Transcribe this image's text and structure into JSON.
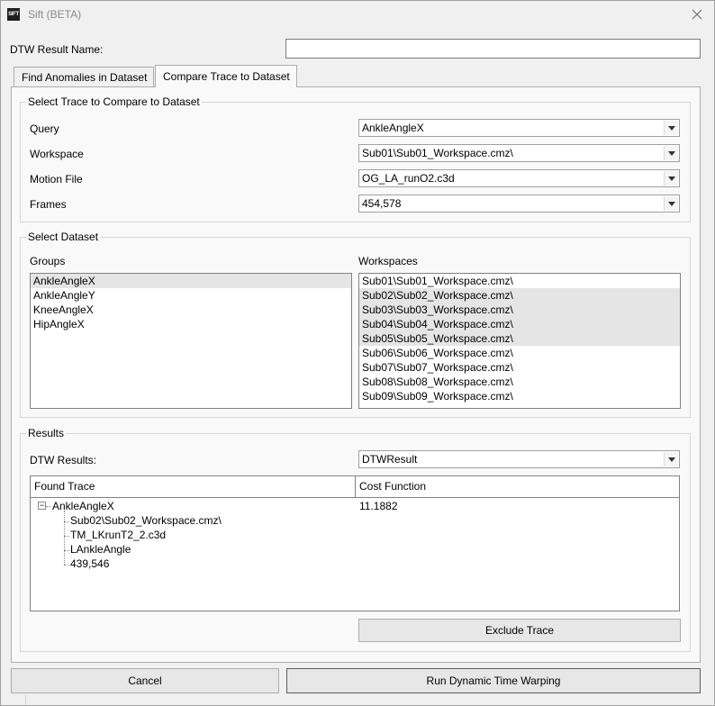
{
  "window": {
    "title": "Sift (BETA)",
    "icon_text": "SIFT"
  },
  "result_name": {
    "label": "DTW Result Name:",
    "value": ""
  },
  "tabs": [
    {
      "label": "Find Anomalies in Dataset"
    },
    {
      "label": "Compare Trace to Dataset"
    }
  ],
  "select_trace": {
    "title": "Select Trace to Compare to Dataset",
    "fields": [
      {
        "label": "Query",
        "value": "AnkleAngleX"
      },
      {
        "label": "Workspace",
        "value": "Sub01\\Sub01_Workspace.cmz\\"
      },
      {
        "label": "Motion File",
        "value": "OG_LA_runO2.c3d"
      },
      {
        "label": "Frames",
        "value": "454,578"
      }
    ]
  },
  "select_dataset": {
    "title": "Select Dataset",
    "groups_label": "Groups",
    "groups": [
      "AnkleAngleX",
      "AnkleAngleY",
      "KneeAngleX",
      "HipAngleX"
    ],
    "workspaces_label": "Workspaces",
    "workspaces": [
      "Sub01\\Sub01_Workspace.cmz\\",
      "Sub02\\Sub02_Workspace.cmz\\",
      "Sub03\\Sub03_Workspace.cmz\\",
      "Sub04\\Sub04_Workspace.cmz\\",
      "Sub05\\Sub05_Workspace.cmz\\",
      "Sub06\\Sub06_Workspace.cmz\\",
      "Sub07\\Sub07_Workspace.cmz\\",
      "Sub08\\Sub08_Workspace.cmz\\",
      "Sub09\\Sub09_Workspace.cmz\\"
    ]
  },
  "results": {
    "title": "Results",
    "dtw_label": "DTW Results:",
    "dtw_value": "DTWResult",
    "columns": [
      "Found Trace",
      "Cost Function"
    ],
    "tree": {
      "root_label": "AnkleAngleX",
      "root_cost": "11.1882",
      "expander": "−",
      "children": [
        "Sub02\\Sub02_Workspace.cmz\\",
        "TM_LKrunT2_2.c3d",
        "LAnkleAngle",
        "439,546"
      ]
    },
    "exclude_button": "Exclude Trace"
  },
  "footer": {
    "cancel_button": "Cancel",
    "run_button": "Run Dynamic Time Warping"
  }
}
